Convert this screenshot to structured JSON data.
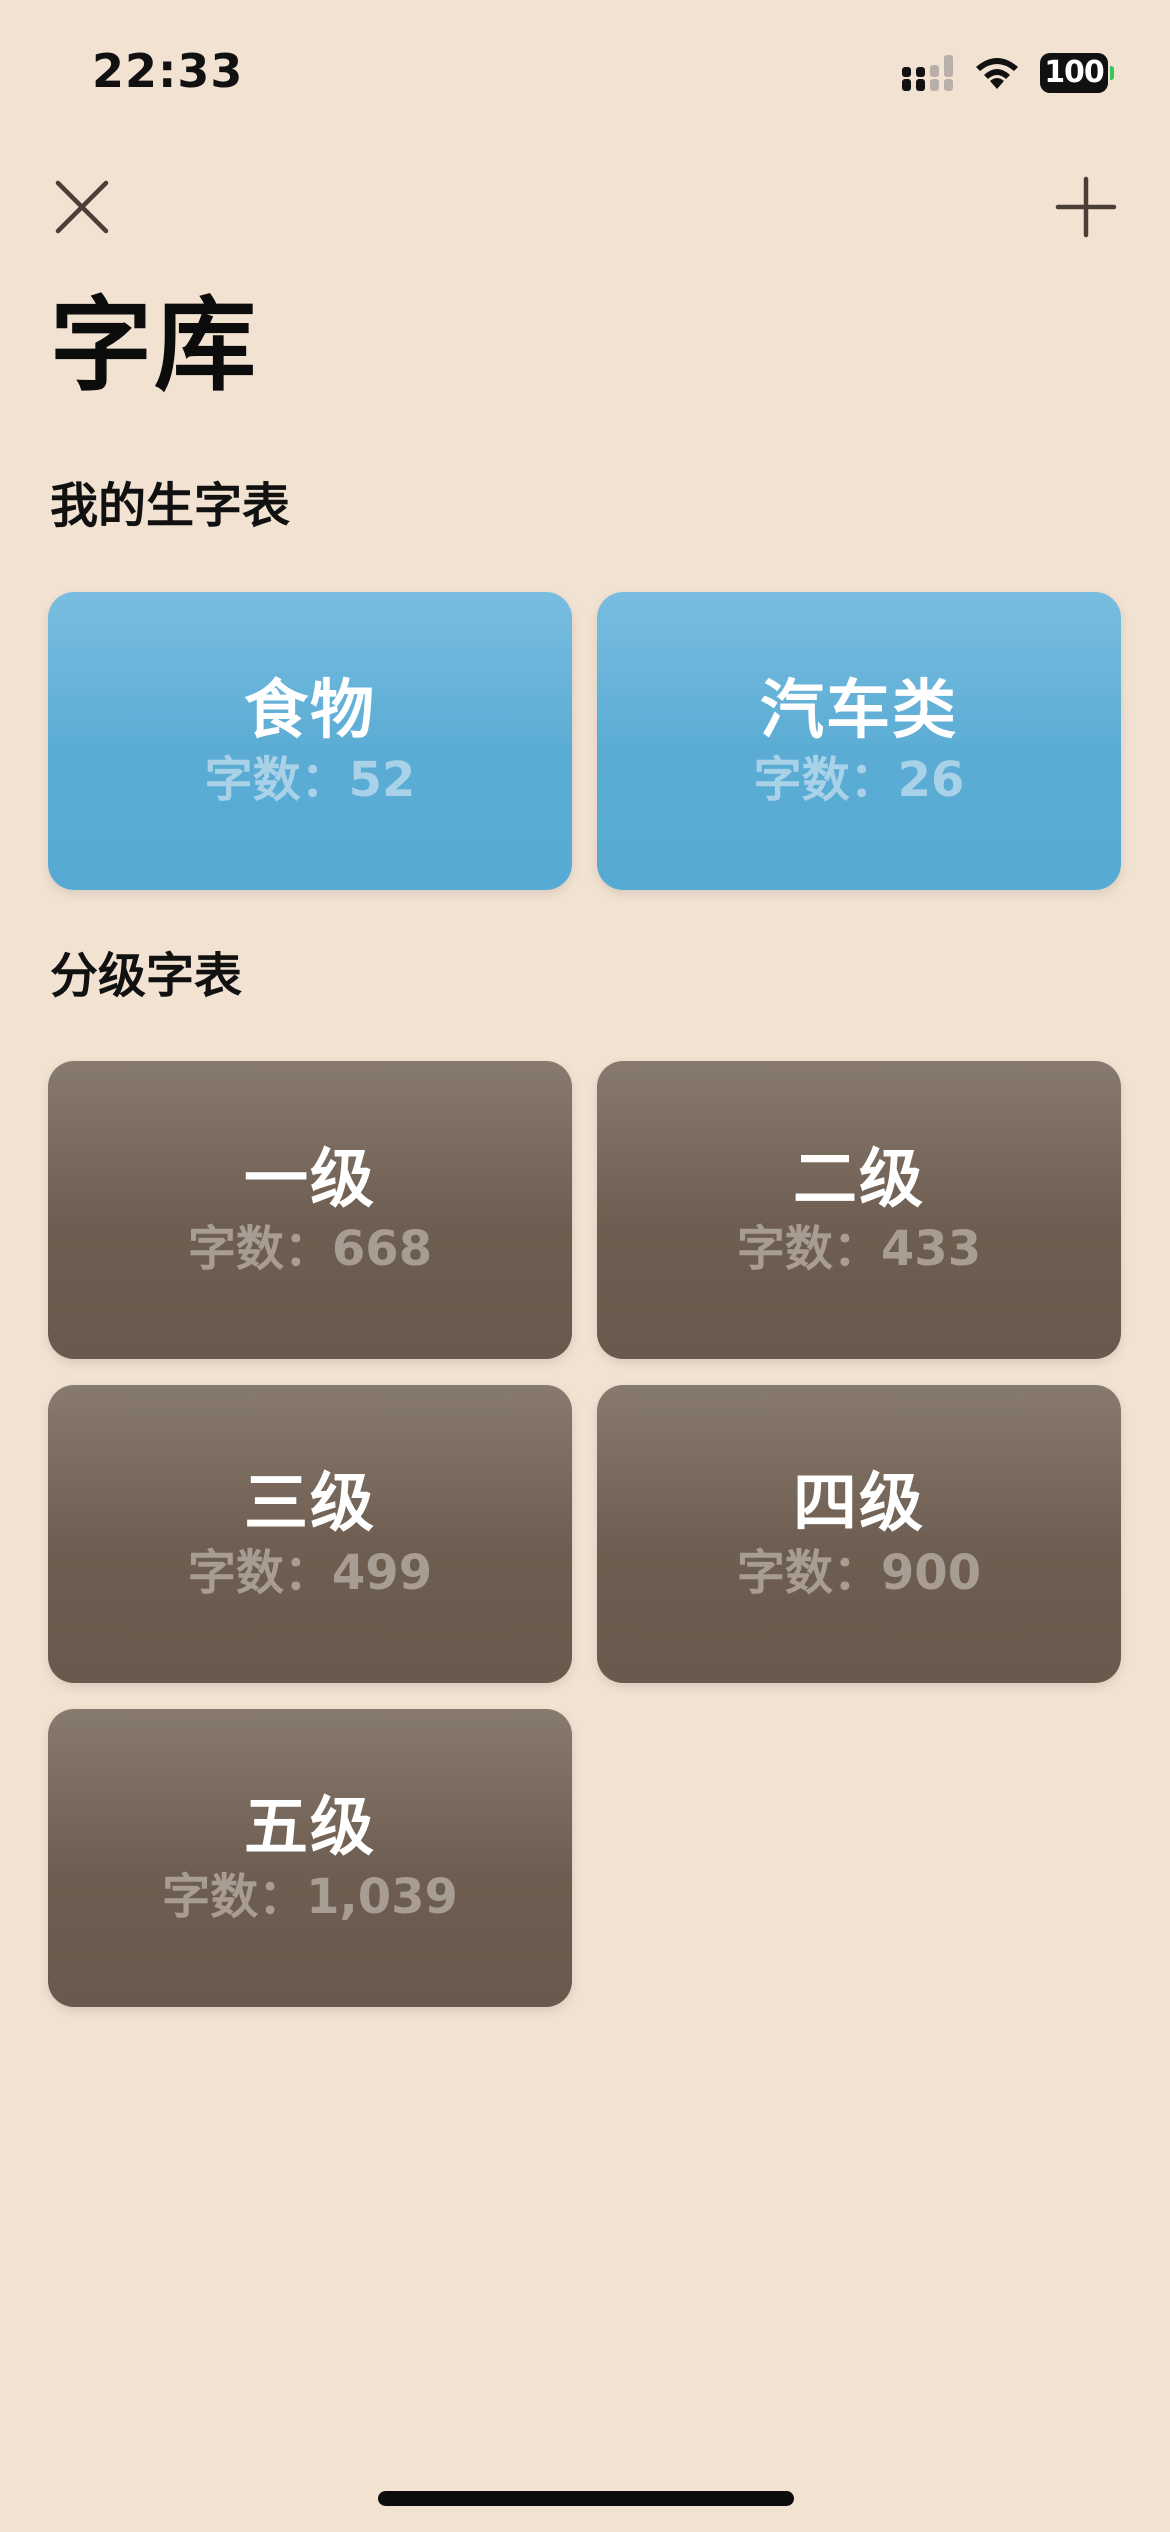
{
  "status_bar": {
    "time": "22:33",
    "battery": "100"
  },
  "nav": {
    "close_icon": "close-icon",
    "add_icon": "plus-icon"
  },
  "page": {
    "title": "字库"
  },
  "sections": {
    "mine": {
      "title": "我的生字表",
      "cards": [
        {
          "name": "食物",
          "count": "字数：52"
        },
        {
          "name": "汽车类",
          "count": "字数：26"
        }
      ]
    },
    "graded": {
      "title": "分级字表",
      "cards": [
        {
          "name": "一级",
          "count": "字数：668"
        },
        {
          "name": "二级",
          "count": "字数：433"
        },
        {
          "name": "三级",
          "count": "字数：499"
        },
        {
          "name": "四级",
          "count": "字数：900"
        },
        {
          "name": "五级",
          "count": "字数：1,039"
        }
      ]
    }
  },
  "colors": {
    "background": "#f2e2d2",
    "blue_card": "#5aacd4",
    "brown_card": "#6e5e51",
    "battery_tip": "#33c759"
  }
}
